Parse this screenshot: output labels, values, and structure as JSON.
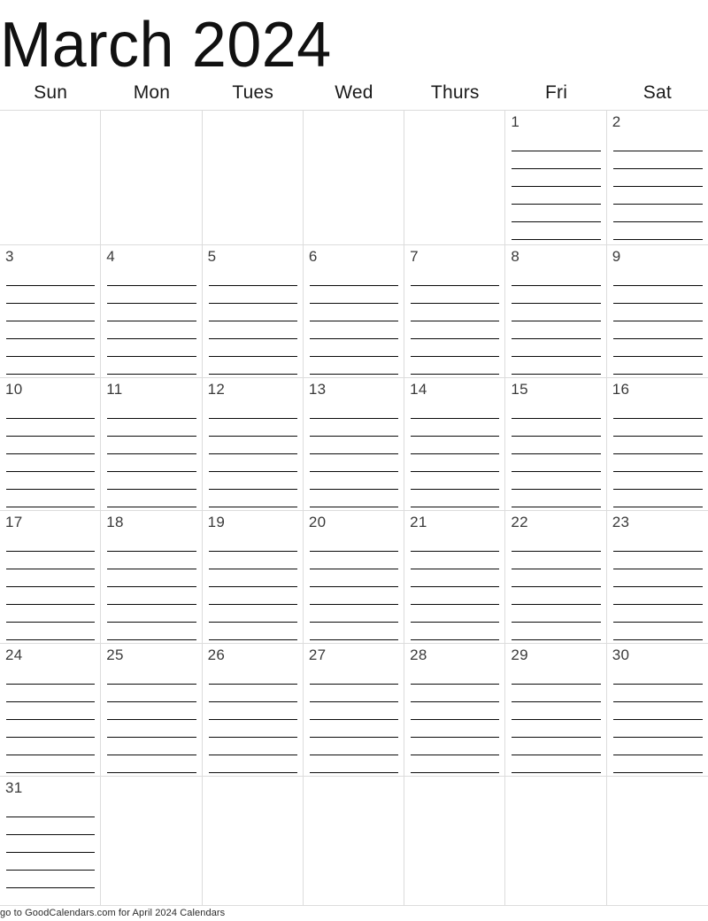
{
  "calendar": {
    "title": "March 2024",
    "month": "March",
    "year": "2024",
    "weekdays": [
      "Sun",
      "Mon",
      "Tues",
      "Wed",
      "Thurs",
      "Fri",
      "Sat"
    ],
    "lines_per_day": 6,
    "grid_line_color": "#dcdcdc",
    "writing_line_color": "#0a0a0a",
    "text_color": "#1a1a1a",
    "weeks": [
      {
        "days": [
          "",
          "",
          "",
          "",
          "",
          "1",
          "2"
        ]
      },
      {
        "days": [
          "3",
          "4",
          "5",
          "6",
          "7",
          "8",
          "9"
        ]
      },
      {
        "days": [
          "10",
          "11",
          "12",
          "13",
          "14",
          "15",
          "16"
        ]
      },
      {
        "days": [
          "17",
          "18",
          "19",
          "20",
          "21",
          "22",
          "23"
        ]
      },
      {
        "days": [
          "24",
          "25",
          "26",
          "27",
          "28",
          "29",
          "30"
        ]
      },
      {
        "days": [
          "31",
          "",
          "",
          "",
          "",
          "",
          ""
        ]
      }
    ]
  },
  "footer": {
    "text": "go to GoodCalendars.com for April 2024 Calendars"
  }
}
